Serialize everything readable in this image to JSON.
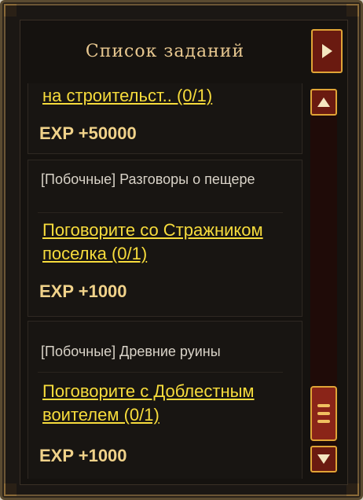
{
  "panel": {
    "title": "Список заданий"
  },
  "quests": [
    {
      "category": "",
      "task": "на строительст.. (0/1)",
      "exp": "EXP +50000"
    },
    {
      "category": "[Побочные] Разговоры о пещере",
      "task": "Поговорите со Стражником поселка (0/1)",
      "exp": "EXP +1000"
    },
    {
      "category": "[Побочные] Древние руины",
      "task": "Поговорите с Доблестным воителем (0/1)",
      "exp": "EXP +1000"
    }
  ],
  "colors": {
    "accent_gold": "#e0a436",
    "task_text": "#f7dc3c",
    "exp_text": "#f0d28a",
    "button_red": "#6a1a10"
  },
  "icons": {
    "collapse": "triangle-right-icon",
    "scroll_up": "triangle-up-icon",
    "scroll_down": "triangle-down-icon"
  }
}
